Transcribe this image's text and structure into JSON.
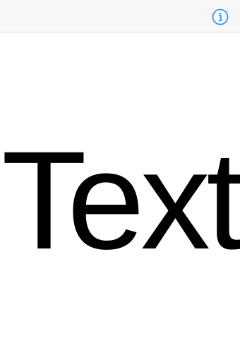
{
  "nav_bar": {
    "info_icon": "info-circle-icon",
    "accent_color": "#1a8cff"
  },
  "content": {
    "display_text": "Text"
  }
}
